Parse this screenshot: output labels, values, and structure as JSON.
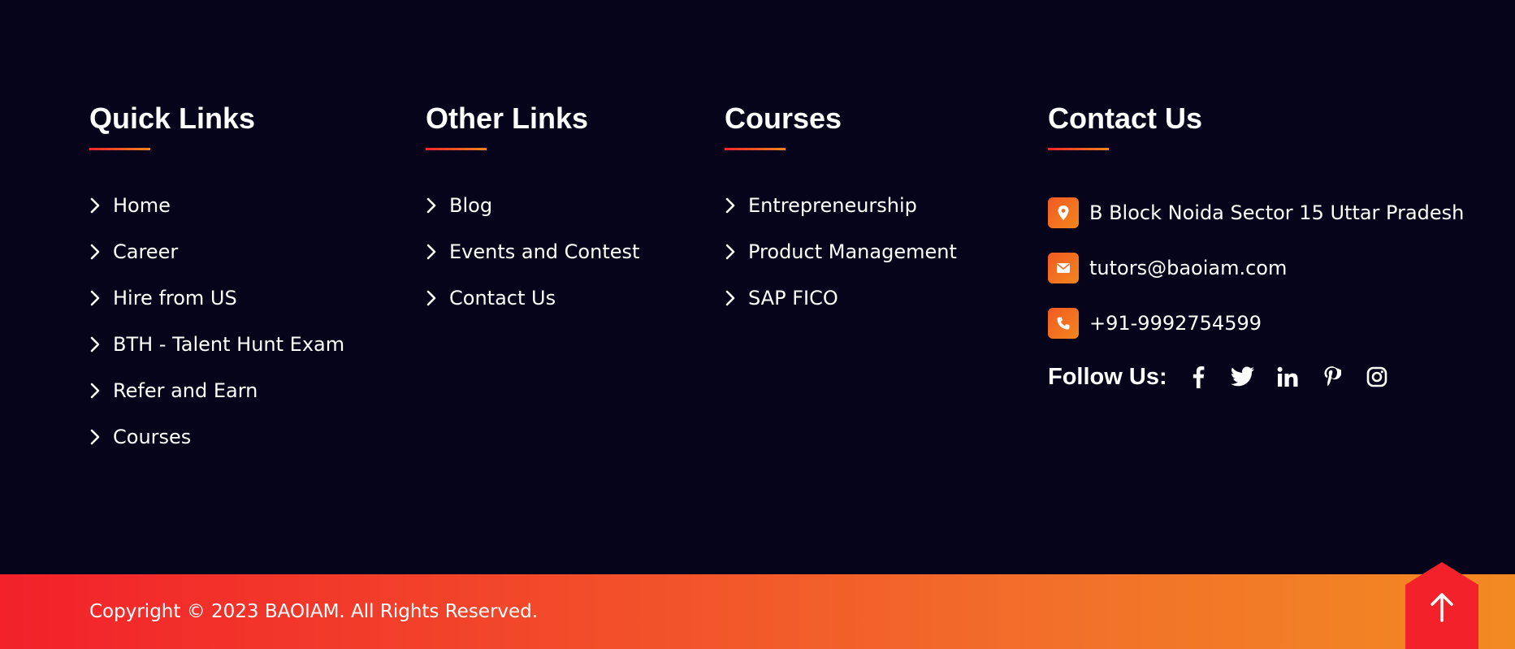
{
  "quick_links": {
    "title": "Quick Links",
    "items": [
      "Home",
      "Career",
      "Hire from US",
      "BTH - Talent Hunt Exam",
      "Refer and Earn",
      "Courses"
    ]
  },
  "other_links": {
    "title": "Other Links",
    "items": [
      "Blog",
      "Events and Contest",
      "Contact Us"
    ]
  },
  "courses": {
    "title": "Courses",
    "items": [
      "Entrepreneurship",
      "Product Management",
      "SAP FICO"
    ]
  },
  "contact": {
    "title": "Contact Us",
    "address": "B Block Noida Sector 15 Uttar Pradesh",
    "email": "tutors@baoiam.com",
    "phone": "+91-9992754599",
    "follow_label": "Follow Us:",
    "socials": [
      "facebook-icon",
      "twitter-icon",
      "linkedin-icon",
      "pinterest-icon",
      "instagram-icon"
    ]
  },
  "bottom": {
    "copyright": "Copyright © 2023 BAOIAM. All Rights Reserved."
  },
  "colors": {
    "background": "#05041a",
    "accent_start": "#f2212a",
    "accent_end": "#f28a22"
  }
}
